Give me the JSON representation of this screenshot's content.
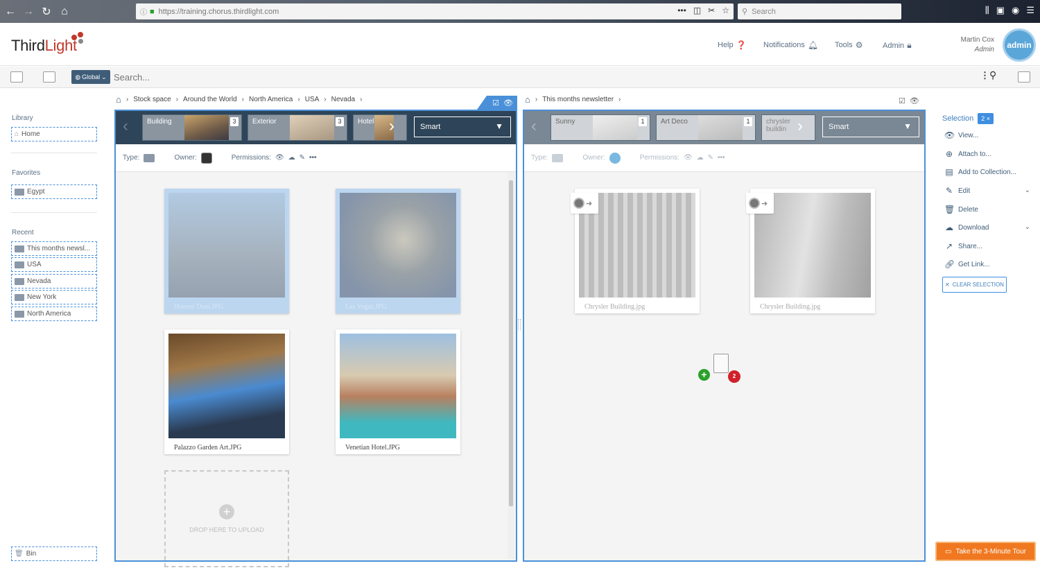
{
  "browser": {
    "url": "https://training.chorus.thirdlight.com",
    "search_placeholder": "Search"
  },
  "header": {
    "logo_third": "Third",
    "logo_light": "Light",
    "links": [
      {
        "label": "Help",
        "icon": "question-icon"
      },
      {
        "label": "Notifications",
        "icon": "bell-icon"
      },
      {
        "label": "Tools",
        "icon": "gear-icon"
      },
      {
        "label": "Admin",
        "icon": "lock-icon"
      }
    ],
    "user_name": "Martin Cox",
    "user_role": "Admin",
    "avatar_label": "admin"
  },
  "toolbar": {
    "scope": "Global",
    "search_placeholder": "Search..."
  },
  "sidebar": {
    "library_heading": "Library",
    "library_items": [
      "Home"
    ],
    "favorites_heading": "Favorites",
    "favorites_items": [
      "Egypt"
    ],
    "recent_heading": "Recent",
    "recent_items": [
      "This months newsl...",
      "USA",
      "Nevada",
      "New York",
      "North America"
    ],
    "bin": "Bin"
  },
  "left_panel": {
    "breadcrumb": [
      "Stock space",
      "Around the World",
      "North America",
      "USA",
      "Nevada"
    ],
    "tabs": [
      {
        "label": "Building",
        "count": "3"
      },
      {
        "label": "Exterior",
        "count": "3"
      },
      {
        "label": "Hotel",
        "count": ""
      }
    ],
    "smart_select": "Smart",
    "type_label": "Type:",
    "owner_label": "Owner:",
    "permissions_label": "Permissions:",
    "files": [
      {
        "name": "Hoover Dam.JPG",
        "selected": true
      },
      {
        "name": "Las Vegas.JPG",
        "selected": true
      },
      {
        "name": "Palazzo Garden Art.JPG",
        "selected": false
      },
      {
        "name": "Venetian Hotel.JPG",
        "selected": false
      }
    ],
    "upload_text": "DROP HERE TO UPLOAD"
  },
  "right_panel": {
    "breadcrumb": [
      "This months newsletter"
    ],
    "tabs": [
      {
        "label": "Sunny",
        "count": "1"
      },
      {
        "label": "Art Deco",
        "count": "1"
      },
      {
        "label": "chrysler buildin",
        "count": ""
      }
    ],
    "smart_select": "Smart",
    "type_label": "Type:",
    "owner_label": "Owner:",
    "permissions_label": "Permissions:",
    "files": [
      {
        "name": "Chrysler Building.jpg"
      },
      {
        "name": "Chrysler Building.jpg"
      }
    ],
    "drag_count": "2"
  },
  "actions": {
    "selection_label": "Selection",
    "selection_count": "2 ×",
    "items": [
      {
        "label": "View...",
        "icon": "eye-icon",
        "dropdown": false
      },
      {
        "label": "Attach to...",
        "icon": "attach-icon",
        "dropdown": false
      },
      {
        "label": "Add to Collection...",
        "icon": "collection-icon",
        "dropdown": false
      },
      {
        "label": "Edit",
        "icon": "pencil-icon",
        "dropdown": true
      },
      {
        "label": "Delete",
        "icon": "trash-icon",
        "dropdown": false
      },
      {
        "label": "Download",
        "icon": "cloud-download-icon",
        "dropdown": true
      },
      {
        "label": "Share...",
        "icon": "share-icon",
        "dropdown": false
      },
      {
        "label": "Get Link...",
        "icon": "link-icon",
        "dropdown": false
      }
    ],
    "clear_selection": "CLEAR SELECTION"
  },
  "tour_button": "Take the 3-Minute Tour",
  "colors": {
    "accent": "#4a90d9",
    "panel_bar": "#2e4458",
    "tour": "#f07820",
    "drag_badge": "#d0202a",
    "drag_plus": "#2ca02c"
  }
}
